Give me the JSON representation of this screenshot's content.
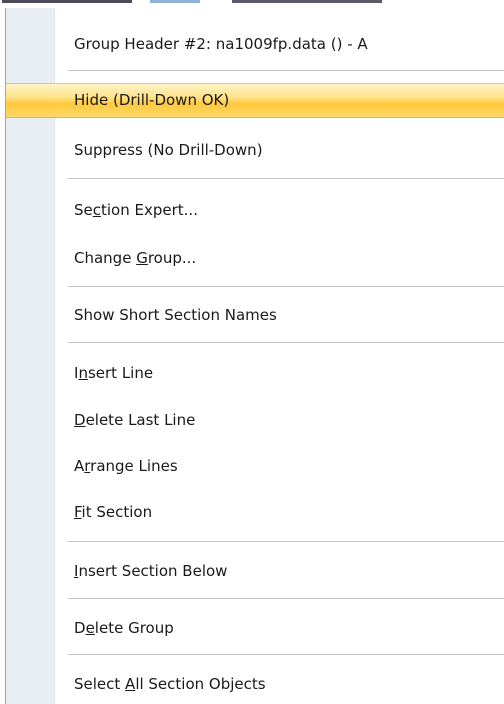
{
  "menu": {
    "items": [
      {
        "id": "group-header",
        "pre": "Group Header #2: na1009fp.data () - A",
        "ul": "",
        "post": ""
      },
      {
        "id": "hide",
        "pre": "Hide (Drill-Down OK)",
        "ul": "",
        "post": ""
      },
      {
        "id": "suppress",
        "pre": "Suppress (No Drill-Down)",
        "ul": "",
        "post": ""
      },
      {
        "id": "section-expert",
        "pre": "Se",
        "ul": "c",
        "post": "tion Expert..."
      },
      {
        "id": "change-group",
        "pre": "Change ",
        "ul": "G",
        "post": "roup..."
      },
      {
        "id": "show-short",
        "pre": "Show Short Section Names",
        "ul": "",
        "post": ""
      },
      {
        "id": "insert-line",
        "pre": "I",
        "ul": "n",
        "post": "sert Line"
      },
      {
        "id": "delete-last",
        "pre": "",
        "ul": "D",
        "post": "elete Last Line"
      },
      {
        "id": "arrange-lines",
        "pre": "A",
        "ul": "r",
        "post": "range Lines"
      },
      {
        "id": "fit-section",
        "pre": "",
        "ul": "F",
        "post": "it Section"
      },
      {
        "id": "insert-below",
        "pre": "",
        "ul": "I",
        "post": "nsert Section Below"
      },
      {
        "id": "delete-group",
        "pre": "D",
        "ul": "e",
        "post": "lete Group"
      },
      {
        "id": "select-all",
        "pre": "Select ",
        "ul": "A",
        "post": "ll Section Objects"
      }
    ],
    "highlighted": "hide",
    "colors": {
      "highlight": "#ffc93d",
      "gutter": "#e9eef2",
      "separator": "#c5c5c5"
    }
  }
}
